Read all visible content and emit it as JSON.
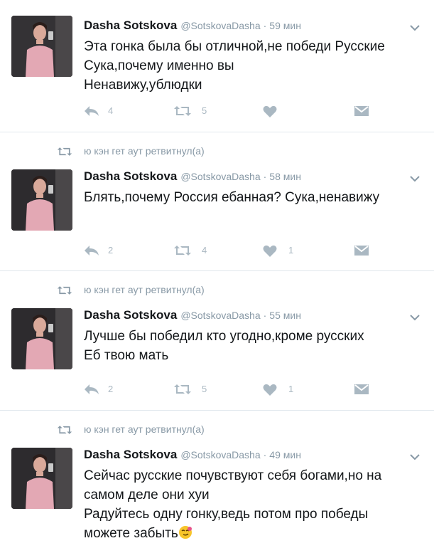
{
  "retweet_label": "ю кэн гет аут ретвитнул(а)",
  "tweets": [
    {
      "name": "Dasha Sotskova",
      "handle": "@SotskovaDasha",
      "separator": "·",
      "time": "59 мин",
      "lines": [
        "Эта гонка была бы отличной,не победи Русские",
        "Сука,почему именно вы",
        "Ненавижу,ублюдки"
      ],
      "reply_count": "4",
      "retweet_count": "5",
      "like_count": ""
    },
    {
      "name": "Dasha Sotskova",
      "handle": "@SotskovaDasha",
      "separator": "·",
      "time": "58 мин",
      "lines": [
        "Блять,почему Россия ебанная? Сука,ненавижу"
      ],
      "reply_count": "2",
      "retweet_count": "4",
      "like_count": "1"
    },
    {
      "name": "Dasha Sotskova",
      "handle": "@SotskovaDasha",
      "separator": "·",
      "time": "55 мин",
      "lines": [
        "Лучше бы победил кто угодно,кроме русских",
        "Еб твою мать"
      ],
      "reply_count": "2",
      "retweet_count": "5",
      "like_count": "1"
    },
    {
      "name": "Dasha Sotskova",
      "handle": "@SotskovaDasha",
      "separator": "·",
      "time": "49 мин",
      "lines": [
        "Сейчас русские почувствуют себя богами,но на",
        "самом деле они хуи",
        "Радуйтесь одну гонку,ведь потом про победы",
        "можете забыть"
      ],
      "trailing_emoji": "smirk-emoji"
    }
  ],
  "colors": {
    "text": "#14171a",
    "muted": "#8899a6",
    "icon": "#aab8c2",
    "divider": "#e1e8ed"
  }
}
